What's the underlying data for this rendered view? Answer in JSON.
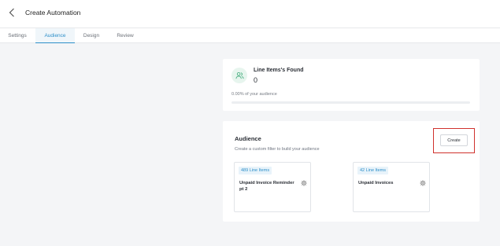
{
  "header": {
    "title": "Create Automation",
    "back_icon": "chevron-left-icon"
  },
  "tabs": [
    {
      "label": "Settings",
      "active": false
    },
    {
      "label": "Audience",
      "active": true
    },
    {
      "label": "Design",
      "active": false
    },
    {
      "label": "Review",
      "active": false
    }
  ],
  "stats": {
    "label": "Line Items's Found",
    "value": "0",
    "percent_text": "0.00% of your audience",
    "progress_fraction": 0,
    "icon": "users-icon"
  },
  "audience": {
    "title": "Audience",
    "subtitle": "Create a custom filter to build your audience",
    "create_label": "Create",
    "segments": [
      {
        "badge": "489 Line Items",
        "name": "Unpaid Invoice Reminder pt 2",
        "icon": "gear-icon"
      },
      {
        "badge": "42 Line Items",
        "name": "Unpaid Invoices",
        "icon": "gear-icon"
      }
    ]
  },
  "colors": {
    "accent": "#2d8fc9",
    "highlight": "#d0312d",
    "icon_bg": "#e7f5ee",
    "icon_fg": "#3aa876"
  }
}
